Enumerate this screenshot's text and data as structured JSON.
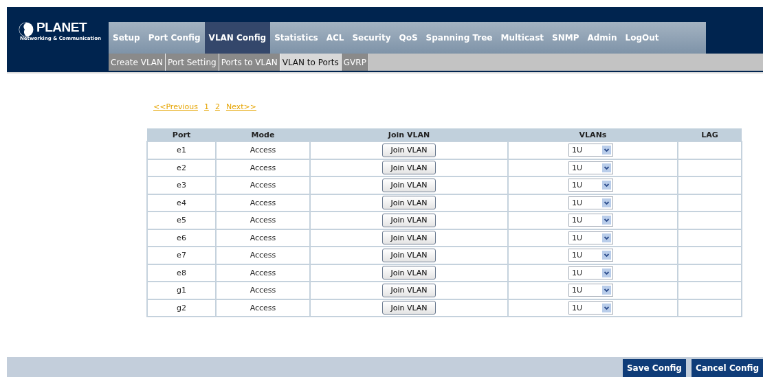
{
  "logo": {
    "name": "PLANET",
    "tagline": "Networking & Communication"
  },
  "menu": [
    {
      "label": "Setup",
      "selected": false
    },
    {
      "label": "Port Config",
      "selected": false
    },
    {
      "label": "VLAN Config",
      "selected": true
    },
    {
      "label": "Statistics",
      "selected": false
    },
    {
      "label": "ACL",
      "selected": false
    },
    {
      "label": "Security",
      "selected": false
    },
    {
      "label": "QoS",
      "selected": false
    },
    {
      "label": "Spanning Tree",
      "selected": false
    },
    {
      "label": "Multicast",
      "selected": false
    },
    {
      "label": "SNMP",
      "selected": false
    },
    {
      "label": "Admin",
      "selected": false
    },
    {
      "label": "LogOut",
      "selected": false
    }
  ],
  "submenu": [
    {
      "label": "Create VLAN",
      "selected": false
    },
    {
      "label": "Port Setting",
      "selected": false
    },
    {
      "label": "Ports to VLAN",
      "selected": false
    },
    {
      "label": "VLAN to Ports",
      "selected": true
    },
    {
      "label": "GVRP",
      "selected": false
    }
  ],
  "pagination": [
    "<<Previous",
    "1",
    "2",
    "Next>>"
  ],
  "table": {
    "columns": [
      "Port",
      "Mode",
      "Join VLAN",
      "VLANs",
      "LAG"
    ],
    "rows": [
      {
        "port": "e1",
        "mode": "Access",
        "button": "Join VLAN",
        "vlans": "1U"
      },
      {
        "port": "e2",
        "mode": "Access",
        "button": "Join VLAN",
        "vlans": "1U"
      },
      {
        "port": "e3",
        "mode": "Access",
        "button": "Join VLAN",
        "vlans": "1U"
      },
      {
        "port": "e4",
        "mode": "Access",
        "button": "Join VLAN",
        "vlans": "1U"
      },
      {
        "port": "e5",
        "mode": "Access",
        "button": "Join VLAN",
        "vlans": "1U"
      },
      {
        "port": "e6",
        "mode": "Access",
        "button": "Join VLAN",
        "vlans": "1U"
      },
      {
        "port": "e7",
        "mode": "Access",
        "button": "Join VLAN",
        "vlans": "1U"
      },
      {
        "port": "e8",
        "mode": "Access",
        "button": "Join VLAN",
        "vlans": "1U"
      },
      {
        "port": "g1",
        "mode": "Access",
        "button": "Join VLAN",
        "vlans": "1U"
      },
      {
        "port": "g2",
        "mode": "Access",
        "button": "Join VLAN",
        "vlans": "1U"
      }
    ]
  },
  "buttons": [
    "Save Config",
    "Cancel Config"
  ]
}
